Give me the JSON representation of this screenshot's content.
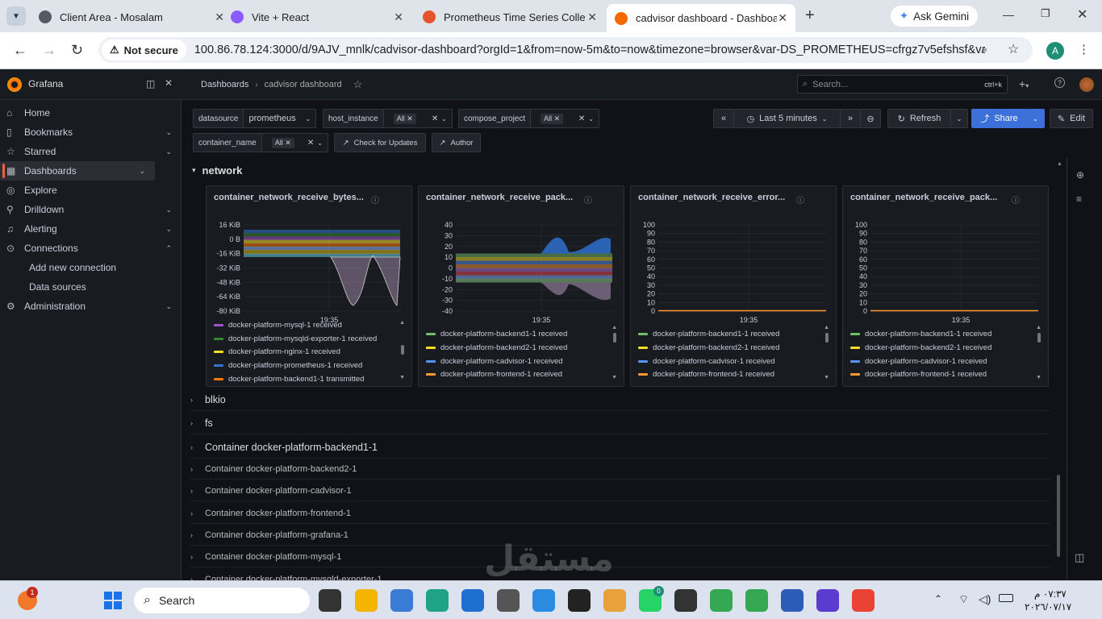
{
  "browser": {
    "tabs": [
      {
        "title": "Client Area - Mosalam",
        "color": "#555a64"
      },
      {
        "title": "Vite + React",
        "color": "#8a5cff"
      },
      {
        "title": "Prometheus Time Series Collect",
        "color": "#e6522c"
      },
      {
        "title": "cadvisor dashboard - Dashboar",
        "color": "#f46800"
      }
    ],
    "ask_gemini": "Ask Gemini",
    "not_secure": "Not secure",
    "url": "100.86.78.124:3000/d/9AJV_mnlk/cadvisor-dashboard?orgId=1&from=now-5m&to=now&timezone=browser&var-DS_PROMETHEUS=cfrgz7v5efshsf&var-h...",
    "profile_initial": "A"
  },
  "grafana": {
    "brand": "Grafana",
    "breadcrumb": {
      "root": "Dashboards",
      "current": "cadvisor dashboard"
    },
    "search": {
      "placeholder": "Search...",
      "shortcut": "ctrl+k"
    },
    "nav": [
      {
        "label": "Home",
        "icon": "home-icon"
      },
      {
        "label": "Bookmarks",
        "icon": "bookmark-icon"
      },
      {
        "label": "Starred",
        "icon": "star-icon"
      },
      {
        "label": "Dashboards",
        "icon": "dashboards-icon"
      },
      {
        "label": "Explore",
        "icon": "compass-icon"
      },
      {
        "label": "Drilldown",
        "icon": "drilldown-icon"
      },
      {
        "label": "Alerting",
        "icon": "bell-icon"
      },
      {
        "label": "Connections",
        "icon": "connections-icon"
      },
      {
        "label": "Add new connection"
      },
      {
        "label": "Data sources"
      },
      {
        "label": "Administration",
        "icon": "gear-icon"
      }
    ],
    "vars": {
      "datasource_label": "datasource",
      "datasource_value": "prometheus",
      "host_label": "host_instance",
      "host_value": "All",
      "compose_label": "compose_project",
      "compose_value": "All",
      "container_label": "container_name",
      "container_value": "All"
    },
    "buttons": {
      "check_updates": "Check for Updates",
      "author": "Author",
      "time_range": "Last 5 minutes",
      "refresh": "Refresh",
      "share": "Share",
      "edit": "Edit"
    },
    "section_network": "network",
    "panels": [
      {
        "title": "container_network_receive_bytes...",
        "y_ticks": [
          "16 KiB",
          "0 B",
          "-16 KiB",
          "-32 KiB",
          "-48 KiB",
          "-64 KiB",
          "-80 KiB"
        ],
        "x_tick": "19:35",
        "legend": [
          {
            "name": "docker-platform-mysql-1 received",
            "color": "#a352cc"
          },
          {
            "name": "docker-platform-mysqld-exporter-1 received",
            "color": "#37872d"
          },
          {
            "name": "docker-platform-nginx-1 received",
            "color": "#fade2a"
          },
          {
            "name": "docker-platform-prometheus-1 received",
            "color": "#3274d9"
          },
          {
            "name": "docker-platform-backend1-1 transmitted",
            "color": "#ff780a"
          }
        ]
      },
      {
        "title": "container_network_receive_pack...",
        "y_ticks": [
          "40",
          "30",
          "20",
          "10",
          "0",
          "-10",
          "-20",
          "-30",
          "-40"
        ],
        "x_tick": "19:35",
        "legend": [
          {
            "name": "docker-platform-backend1-1 received",
            "color": "#73bf69"
          },
          {
            "name": "docker-platform-backend2-1 received",
            "color": "#fade2a"
          },
          {
            "name": "docker-platform-cadvisor-1 received",
            "color": "#5794f2"
          },
          {
            "name": "docker-platform-frontend-1 received",
            "color": "#ff9830"
          }
        ]
      },
      {
        "title": "container_network_receive_error...",
        "y_ticks": [
          "100",
          "90",
          "80",
          "70",
          "60",
          "50",
          "40",
          "30",
          "20",
          "10",
          "0"
        ],
        "x_tick": "19:35",
        "legend": [
          {
            "name": "docker-platform-backend1-1 received",
            "color": "#73bf69"
          },
          {
            "name": "docker-platform-backend2-1 received",
            "color": "#fade2a"
          },
          {
            "name": "docker-platform-cadvisor-1 received",
            "color": "#5794f2"
          },
          {
            "name": "docker-platform-frontend-1 received",
            "color": "#ff9830"
          }
        ]
      },
      {
        "title": "container_network_receive_pack...",
        "y_ticks": [
          "100",
          "90",
          "80",
          "70",
          "60",
          "50",
          "40",
          "30",
          "20",
          "10",
          "0"
        ],
        "x_tick": "19:35",
        "legend": [
          {
            "name": "docker-platform-backend1-1 received",
            "color": "#73bf69"
          },
          {
            "name": "docker-platform-backend2-1 received",
            "color": "#fade2a"
          },
          {
            "name": "docker-platform-cadvisor-1 received",
            "color": "#5794f2"
          },
          {
            "name": "docker-platform-frontend-1 received",
            "color": "#ff9830"
          }
        ]
      }
    ],
    "rows": [
      {
        "label": "blkio",
        "bold": true
      },
      {
        "label": "fs",
        "bold": true
      },
      {
        "label": "Container docker-platform-backend1-1",
        "bold": true
      },
      {
        "label": "Container docker-platform-backend2-1"
      },
      {
        "label": "Container docker-platform-cadvisor-1"
      },
      {
        "label": "Container docker-platform-frontend-1"
      },
      {
        "label": "Container docker-platform-grafana-1"
      },
      {
        "label": "Container docker-platform-mysql-1"
      },
      {
        "label": "Container docker-platform-mysqld-exporter-1"
      }
    ]
  },
  "taskbar": {
    "search_label": "Search",
    "time": "٠٧:٣٧ م",
    "date": "٢٠٢٦/٠٧/١٧",
    "notification_count": "1",
    "whatsapp_badge": "0"
  },
  "watermark": "مستقل"
}
